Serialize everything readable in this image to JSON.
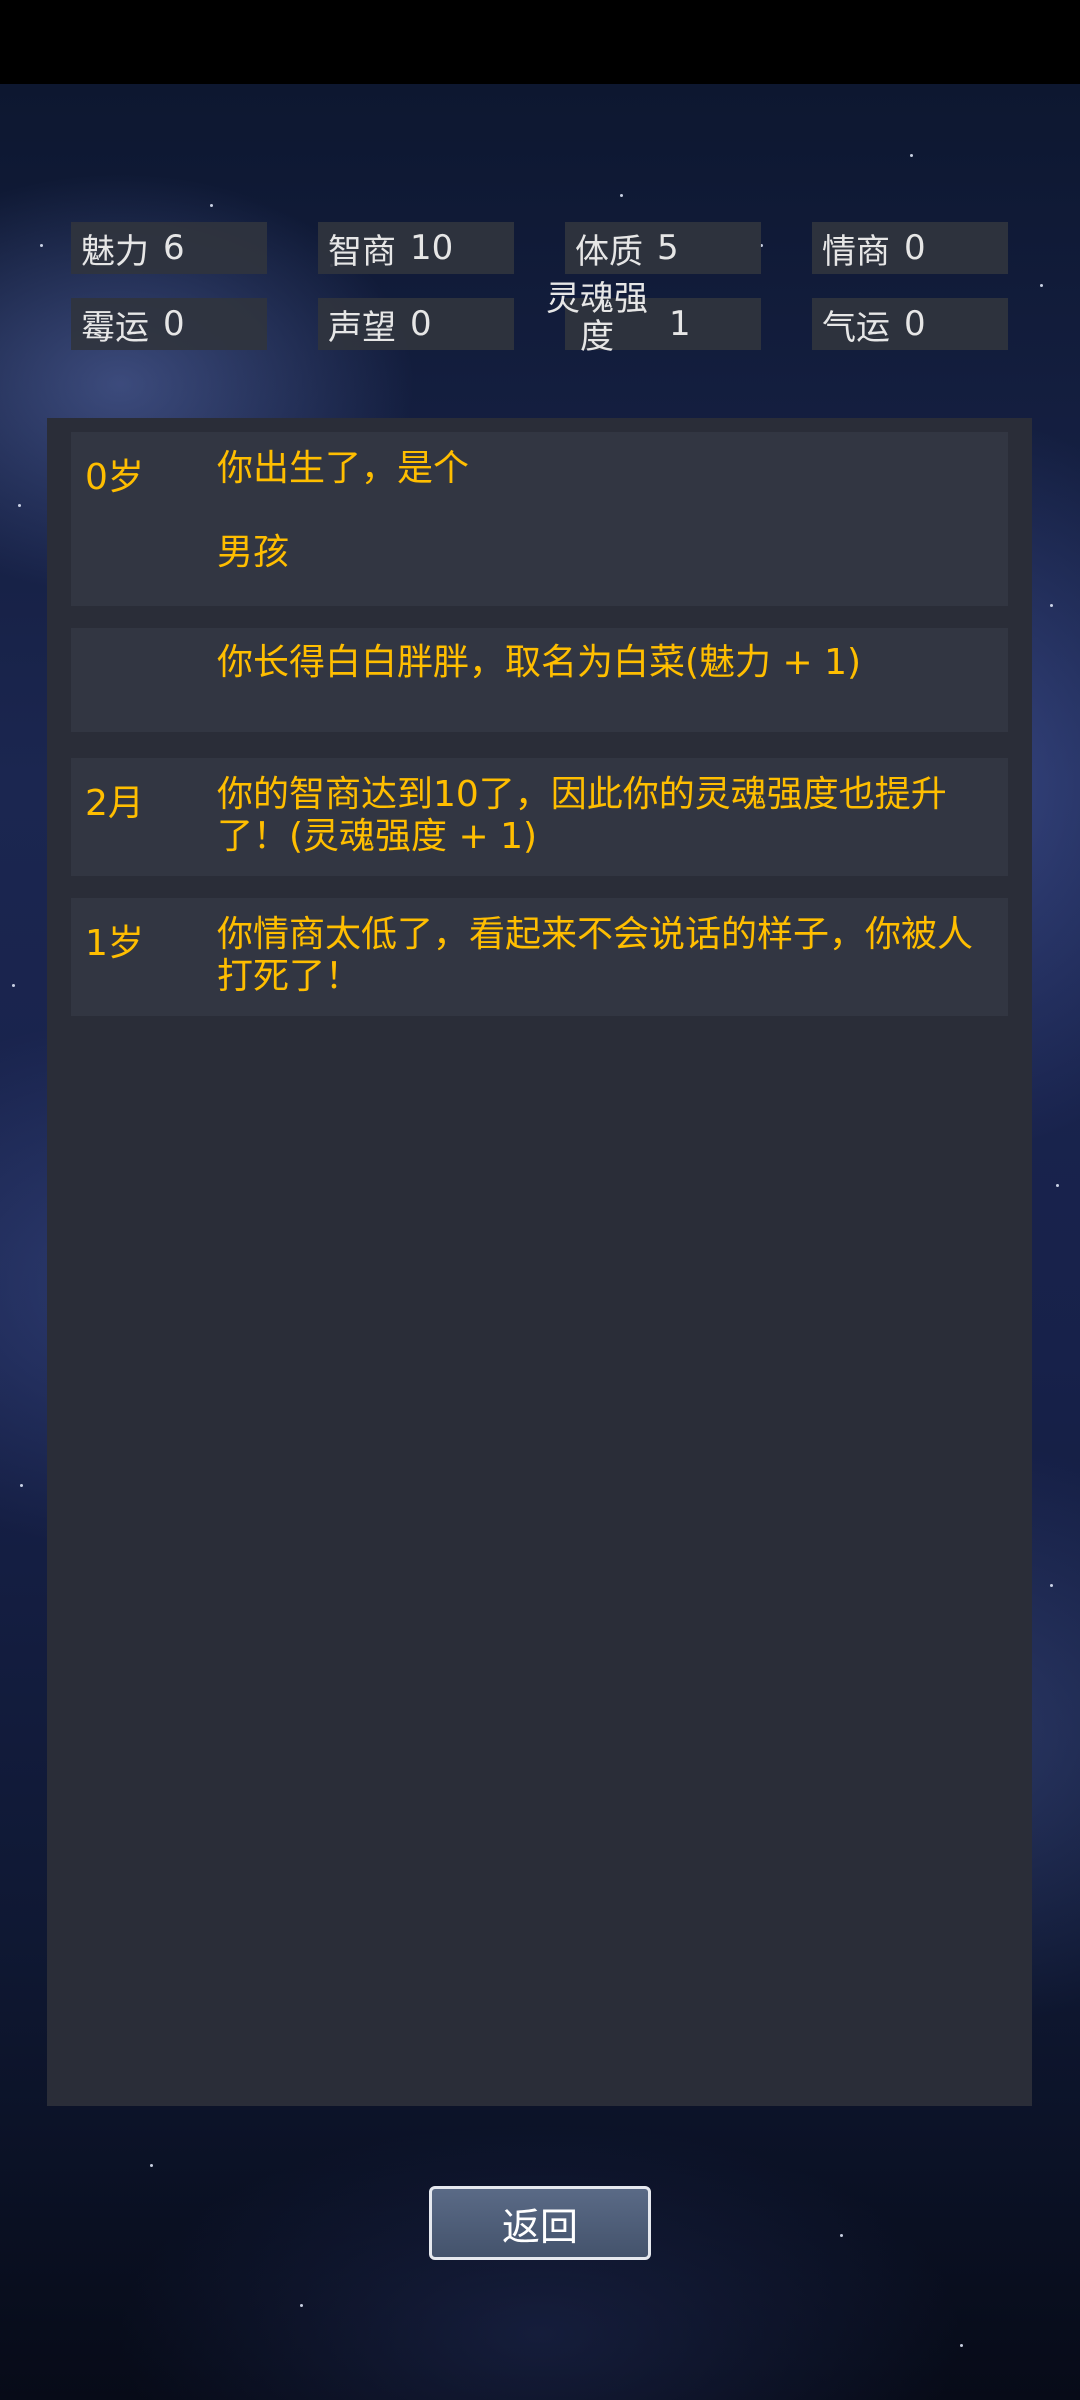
{
  "stats": [
    {
      "label": "魅力",
      "value": "6"
    },
    {
      "label": "智商",
      "value": "10"
    },
    {
      "label": "体质",
      "value": "5"
    },
    {
      "label": "情商",
      "value": "0"
    },
    {
      "label": "霉运",
      "value": "0"
    },
    {
      "label": "声望",
      "value": "0"
    },
    {
      "label": "灵魂强度",
      "value": "1"
    },
    {
      "label": "气运",
      "value": "0"
    }
  ],
  "log": [
    {
      "age": "0岁",
      "text_line1": "你出生了，是个",
      "text_line2": "男孩"
    },
    {
      "age": "",
      "text": "你长得白白胖胖，取名为白菜(魅力 + 1)"
    },
    {
      "age": "2月",
      "text": "你的智商达到10了，因此你的灵魂强度也提升了！(灵魂强度 + 1)"
    },
    {
      "age": "1岁",
      "text": "你情商太低了，看起来不会说话的样子，你被人打死了！"
    }
  ],
  "back_label": "返回"
}
